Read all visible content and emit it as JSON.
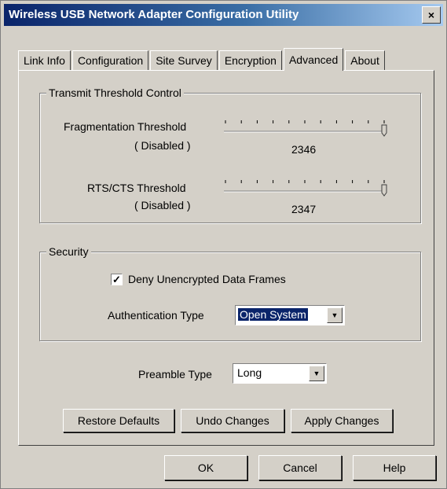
{
  "window": {
    "title": "Wireless USB Network Adapter Configuration Utility",
    "close_label": "×"
  },
  "tabs": [
    {
      "label": "Link Info",
      "active": false
    },
    {
      "label": "Configuration",
      "active": false
    },
    {
      "label": "Site Survey",
      "active": false
    },
    {
      "label": "Encryption",
      "active": false
    },
    {
      "label": "Advanced",
      "active": true
    },
    {
      "label": "About",
      "active": false
    }
  ],
  "transmit": {
    "title": "Transmit Threshold Control",
    "fragmentation": {
      "label": "Fragmentation Threshold",
      "status": "( Disabled )",
      "value": "2346",
      "slider_fraction": 1.0
    },
    "rts": {
      "label": "RTS/CTS Threshold",
      "status": "( Disabled )",
      "value": "2347",
      "slider_fraction": 1.0
    }
  },
  "security": {
    "title": "Security",
    "deny_label": "Deny Unencrypted Data Frames",
    "deny_checked": true,
    "auth_label": "Authentication Type",
    "auth_value": "Open System"
  },
  "preamble": {
    "label": "Preamble Type",
    "value": "Long"
  },
  "actions": {
    "restore": "Restore Defaults",
    "undo": "Undo Changes",
    "apply": "Apply Changes"
  },
  "footer": {
    "ok": "OK",
    "cancel": "Cancel",
    "help": "Help"
  },
  "icons": {
    "checkmark": "checkmark-icon",
    "dropdown": "dropdown-arrow-icon",
    "close": "close-icon"
  }
}
